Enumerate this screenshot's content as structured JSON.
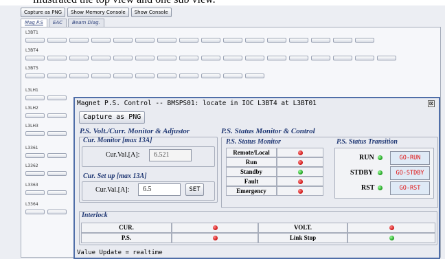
{
  "caption_fragment": "illustrated the top view and one sub view.",
  "background": {
    "toolbar": [
      "Capture as PNG",
      "Show Memory Console",
      "Show Console"
    ],
    "tabs": [
      "Mag P.S",
      "EAC",
      "Beam Diag."
    ],
    "active_tab": "Mag P.S",
    "group_labels": [
      "L3BT1",
      "L3BT4",
      "L3BT5",
      "L3LH1",
      "L3LH2",
      "L3LH3",
      "L3361",
      "L3362",
      "L3363",
      "L3364"
    ]
  },
  "window": {
    "title": "Magnet P.S. Control -- BMSPS01: locate in IOC L3BT4 at L3BT01",
    "close_glyph": "⊠",
    "capture_label": "Capture as PNG",
    "volt_section": {
      "title": "P.S. Volt./Curr. Monitor & Adjustor",
      "monitor_title": "Cur. Monitor [max 13A]",
      "monitor_label": "Cur.Val.[A]:",
      "monitor_value": "6.521",
      "setup_title": "Cur. Set up [max 13A]",
      "setup_label": "Cur.Val.[A]:",
      "setup_value": "6.5",
      "set_button": "SET"
    },
    "status_section": {
      "title": "P.S. Status Monitor & Control",
      "monitor_title": "P.S. Status Monitor",
      "rows": [
        {
          "label": "Remote/Local",
          "state": "red"
        },
        {
          "label": "Run",
          "state": "red"
        },
        {
          "label": "Standby",
          "state": "green"
        },
        {
          "label": "Fault",
          "state": "red"
        },
        {
          "label": "Emergency",
          "state": "red"
        }
      ],
      "transition_title": "P.S. Status Transition",
      "transitions": [
        {
          "label": "RUN",
          "state": "green",
          "button": "GO-RUN"
        },
        {
          "label": "STDBY",
          "state": "green",
          "button": "GO-STDBY"
        },
        {
          "label": "RST",
          "state": "green",
          "button": "GO-RST"
        }
      ]
    },
    "interlock": {
      "title": "Interlock",
      "items": [
        {
          "label": "CUR.",
          "state": "red"
        },
        {
          "label": "VOLT.",
          "state": "red"
        },
        {
          "label": "P.S.",
          "state": "red"
        },
        {
          "label": "Link Stop",
          "state": "green"
        }
      ]
    },
    "footer": "Value Update = realtime"
  },
  "colors": {
    "accent": "#4f6ea8",
    "title_text": "#1f3773",
    "alarm": "#cc1111",
    "ok": "#1a9a1a",
    "button_text": "#e01010"
  }
}
